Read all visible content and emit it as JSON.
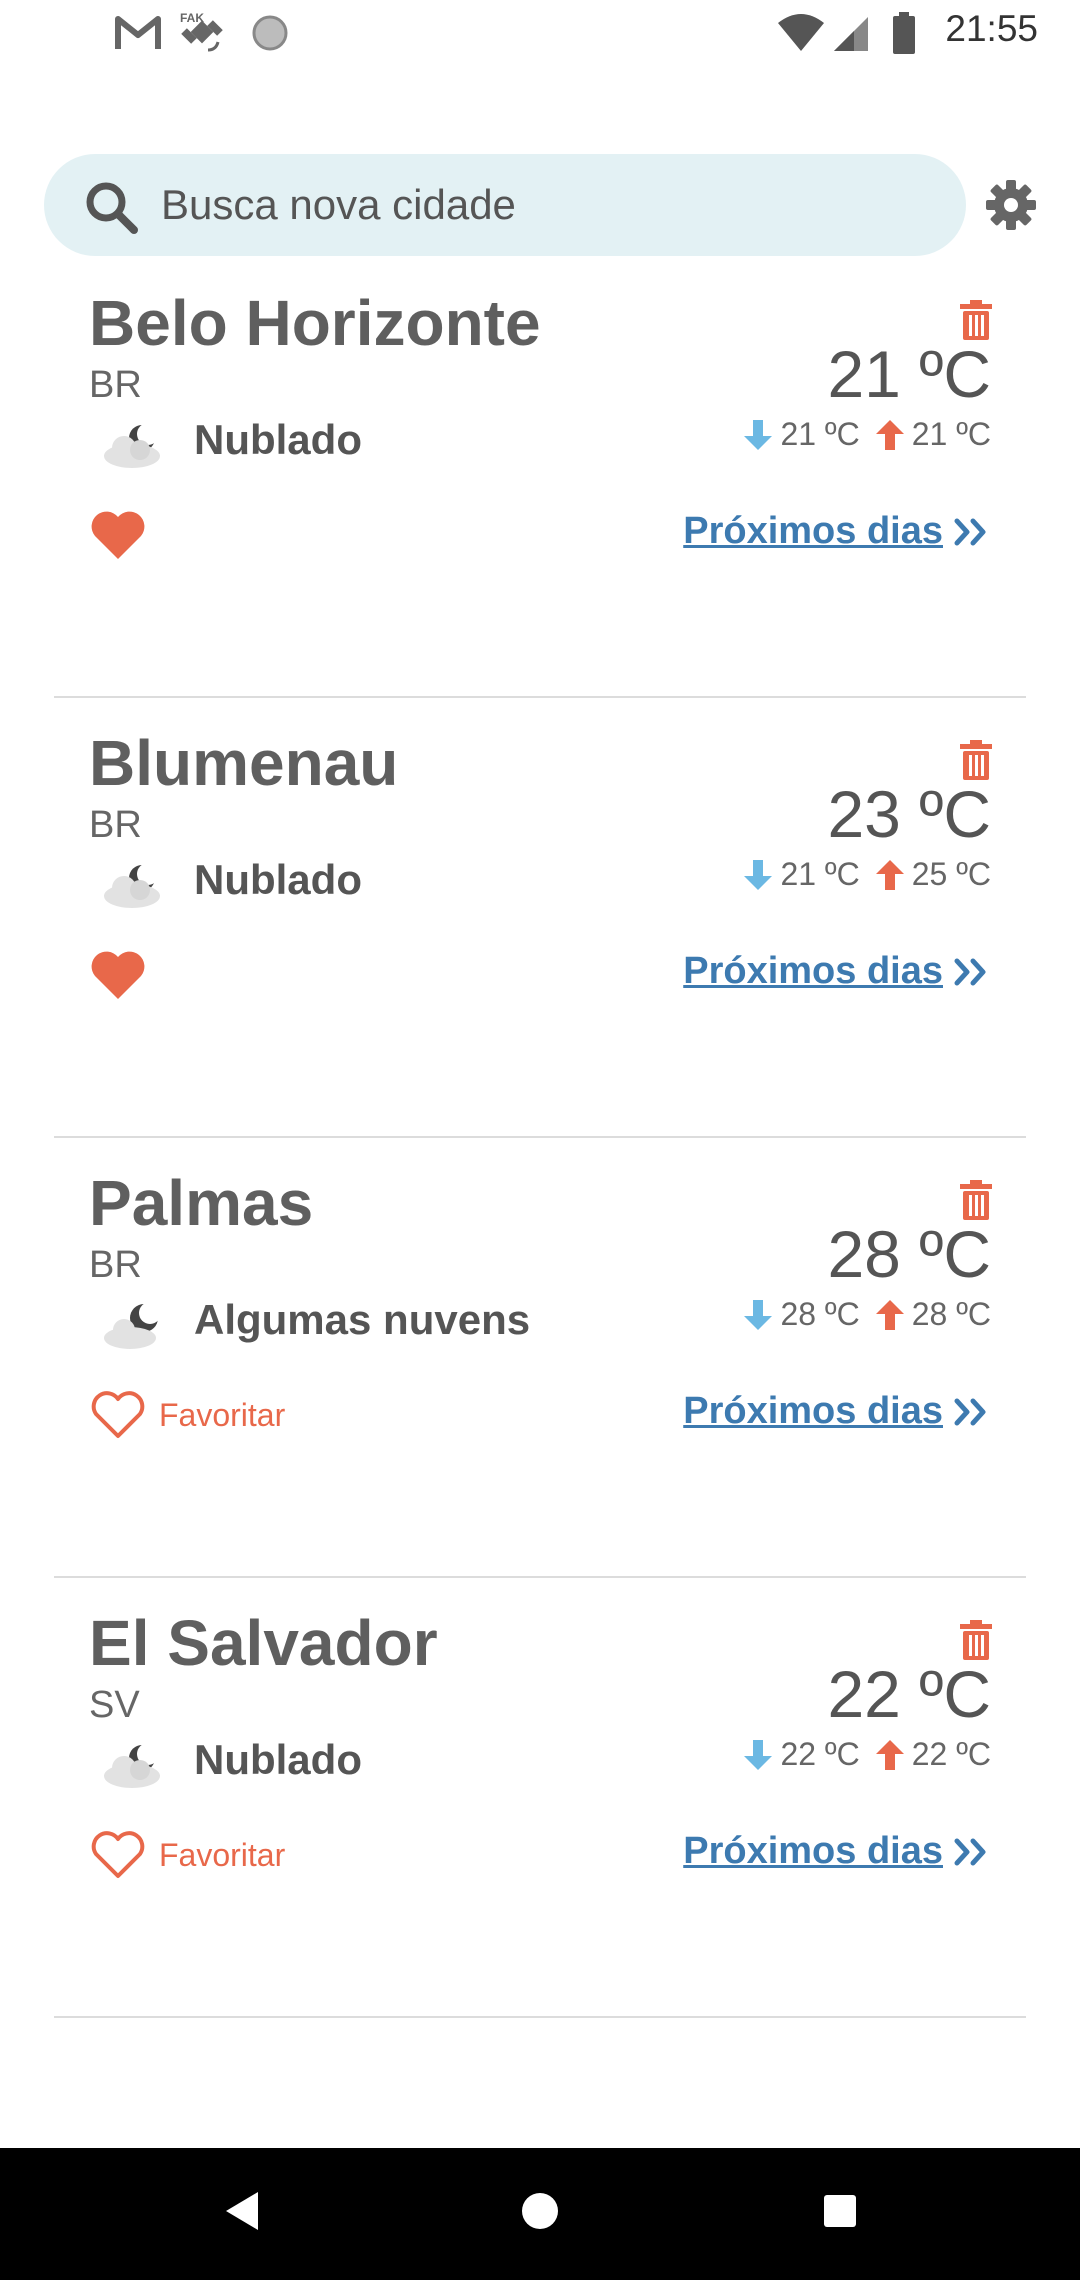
{
  "status_bar": {
    "time": "21:55",
    "left_icons": [
      "gmail-icon",
      "fake-gps-icon",
      "circle-app-icon"
    ],
    "right_icons": [
      "wifi-icon",
      "cell-signal-icon",
      "battery-icon"
    ]
  },
  "search": {
    "placeholder": "Busca nova cidade"
  },
  "colors": {
    "accent": "#e8684a",
    "link": "#3d7ab0",
    "search_bg": "#e3f1f4",
    "min_arrow": "#6bb8e3",
    "max_arrow": "#e8684a"
  },
  "cities": [
    {
      "name": "Belo Horizonte",
      "country": "BR",
      "condition": "Nublado",
      "condition_icon": "cloudy-night-icon",
      "temp": "21 ºC",
      "min": "21 ºC",
      "max": "21 ºC",
      "favorite": true,
      "favorite_label": "",
      "next_days": "Próximos dias"
    },
    {
      "name": "Blumenau",
      "country": "BR",
      "condition": "Nublado",
      "condition_icon": "cloudy-night-icon",
      "temp": "23 ºC",
      "min": "21 ºC",
      "max": "25 ºC",
      "favorite": true,
      "favorite_label": "",
      "next_days": "Próximos dias"
    },
    {
      "name": "Palmas",
      "country": "BR",
      "condition": "Algumas nuvens",
      "condition_icon": "partly-cloudy-night-icon",
      "temp": "28 ºC",
      "min": "28 ºC",
      "max": "28 ºC",
      "favorite": false,
      "favorite_label": "Favoritar",
      "next_days": "Próximos dias"
    },
    {
      "name": "El Salvador",
      "country": "SV",
      "condition": "Nublado",
      "condition_icon": "cloudy-night-icon",
      "temp": "22 ºC",
      "min": "22 ºC",
      "max": "22 ºC",
      "favorite": false,
      "favorite_label": "Favoritar",
      "next_days": "Próximos dias"
    }
  ],
  "nav_bar": {
    "buttons": [
      "back-icon",
      "home-icon",
      "recents-icon"
    ]
  }
}
